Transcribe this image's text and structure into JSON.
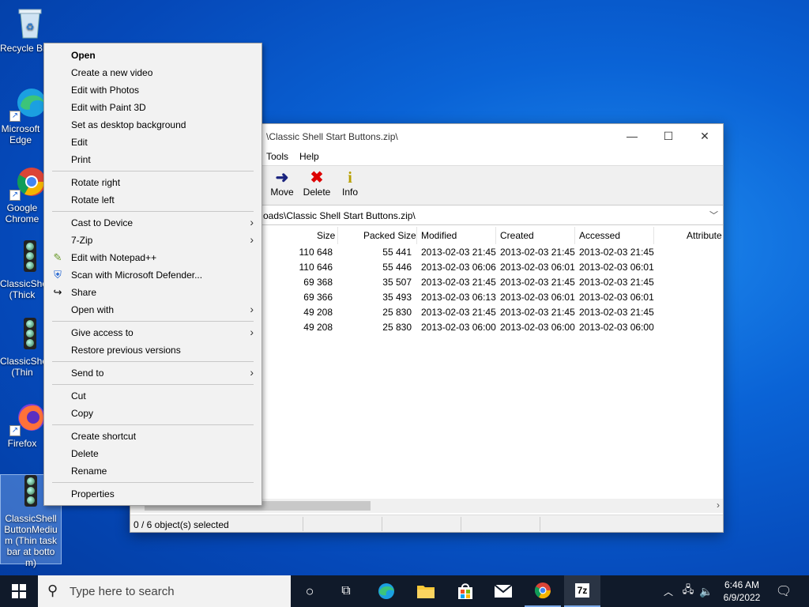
{
  "desktop": {
    "icons": [
      {
        "label": "Recycle Bin"
      },
      {
        "label": "Microsoft Edge"
      },
      {
        "label": "Google Chrome"
      },
      {
        "label": "ClassicShell (Thick taskbar)"
      },
      {
        "label": "ClassicShell (Thin taskbar)"
      },
      {
        "label": "Firefox"
      },
      {
        "label": "ClassicShellButtonMedium (Thin taskbar at bottom)"
      }
    ]
  },
  "window": {
    "title": "\\Classic Shell Start Buttons.zip\\",
    "menu": [
      "Tools",
      "Help"
    ],
    "toolbar": [
      {
        "label": "Move",
        "icon": "arrow-right-icon"
      },
      {
        "label": "Delete",
        "icon": "delete-x-icon"
      },
      {
        "label": "Info",
        "icon": "info-icon"
      }
    ],
    "address": "oads\\Classic Shell Start Buttons.zip\\",
    "columns": [
      "Size",
      "Packed Size",
      "Modified",
      "Created",
      "Accessed",
      "Attribute"
    ],
    "rows": [
      {
        "size": "110 648",
        "packed": "55 441",
        "modified": "2013-02-03 21:45",
        "created": "2013-02-03 21:45",
        "accessed": "2013-02-03 21:45"
      },
      {
        "size": "110 646",
        "packed": "55 446",
        "modified": "2013-02-03 06:06",
        "created": "2013-02-03 06:01",
        "accessed": "2013-02-03 06:01"
      },
      {
        "size": "69 368",
        "packed": "35 507",
        "modified": "2013-02-03 21:45",
        "created": "2013-02-03 21:45",
        "accessed": "2013-02-03 21:45"
      },
      {
        "size": "69 366",
        "packed": "35 493",
        "modified": "2013-02-03 06:13",
        "created": "2013-02-03 06:01",
        "accessed": "2013-02-03 06:01"
      },
      {
        "size": "49 208",
        "packed": "25 830",
        "modified": "2013-02-03 21:45",
        "created": "2013-02-03 21:45",
        "accessed": "2013-02-03 21:45"
      },
      {
        "size": "49 208",
        "packed": "25 830",
        "modified": "2013-02-03 06:00",
        "created": "2013-02-03 06:00",
        "accessed": "2013-02-03 06:00"
      }
    ],
    "status": "0 / 6 object(s) selected"
  },
  "context_menu": {
    "items": [
      {
        "label": "Open"
      },
      {
        "label": "Create a new video"
      },
      {
        "label": "Edit with Photos"
      },
      {
        "label": "Edit with Paint 3D"
      },
      {
        "label": "Set as desktop background"
      },
      {
        "label": "Edit"
      },
      {
        "label": "Print"
      },
      {
        "label": "Rotate right"
      },
      {
        "label": "Rotate left"
      },
      {
        "label": "Cast to Device"
      },
      {
        "label": "7-Zip"
      },
      {
        "label": "Edit with Notepad++"
      },
      {
        "label": "Scan with Microsoft Defender..."
      },
      {
        "label": "Share"
      },
      {
        "label": "Open with"
      },
      {
        "label": "Give access to"
      },
      {
        "label": "Restore previous versions"
      },
      {
        "label": "Send to"
      },
      {
        "label": "Cut"
      },
      {
        "label": "Copy"
      },
      {
        "label": "Create shortcut"
      },
      {
        "label": "Delete"
      },
      {
        "label": "Rename"
      },
      {
        "label": "Properties"
      }
    ]
  },
  "taskbar": {
    "search_placeholder": "Type here to search",
    "time": "6:46 AM",
    "date": "6/9/2022"
  }
}
